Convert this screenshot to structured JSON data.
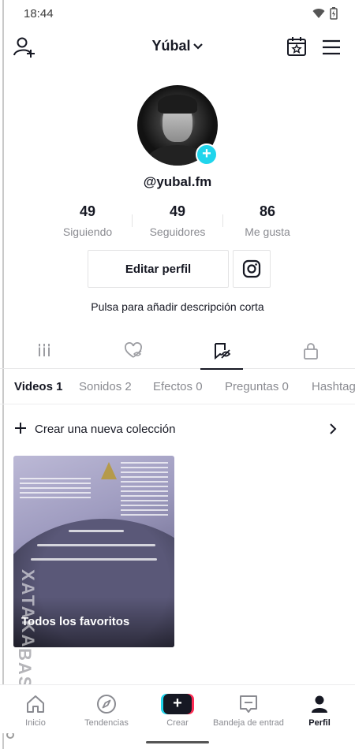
{
  "status_bar": {
    "time": "18:44"
  },
  "header": {
    "title": "Yúbal"
  },
  "profile": {
    "handle": "@yubal.fm",
    "bio_placeholder": "Pulsa para añadir descripción corta"
  },
  "stats": [
    {
      "value": "49",
      "label": "Siguiendo"
    },
    {
      "value": "49",
      "label": "Seguidores"
    },
    {
      "value": "86",
      "label": "Me gusta"
    }
  ],
  "actions": {
    "edit_profile": "Editar perfil"
  },
  "sub_tabs": [
    "Videos 1",
    "Sonidos 2",
    "Efectos 0",
    "Preguntas 0",
    "Hashtag"
  ],
  "collections": {
    "new_label": "Crear una nueva colección",
    "items": [
      {
        "title": "Todos los favoritos"
      }
    ]
  },
  "watermark": "XATAKA BASICS",
  "bottom_nav": [
    {
      "label": "Inicio"
    },
    {
      "label": "Tendencias"
    },
    {
      "label": "Crear"
    },
    {
      "label": "Bandeja de entrada"
    },
    {
      "label": "Perfil"
    }
  ],
  "colors": {
    "accent_cyan": "#20d5ec",
    "accent_red": "#fe2c55",
    "text": "#161823",
    "muted": "#8a8b91"
  },
  "icons": [
    "add-user-icon",
    "chevron-down-icon",
    "calendar-star-icon",
    "menu-icon",
    "instagram-icon",
    "grid-icon",
    "heart-hidden-icon",
    "bookmark-icon",
    "lock-icon",
    "plus-icon",
    "chevron-right-icon",
    "home-icon",
    "compass-icon",
    "inbox-icon",
    "profile-icon"
  ]
}
